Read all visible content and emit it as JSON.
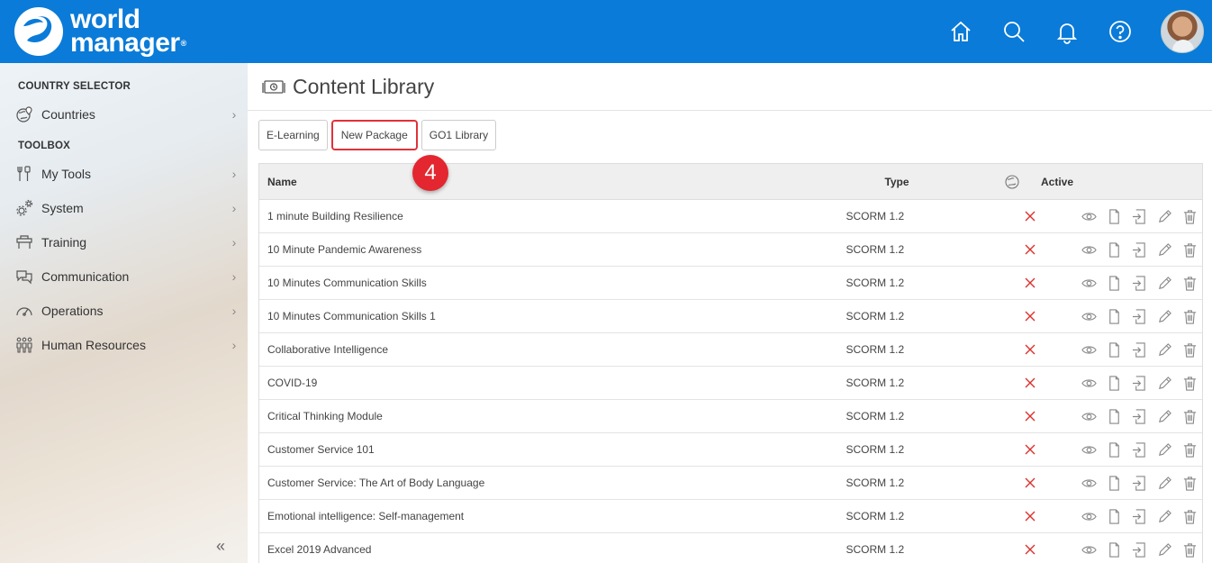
{
  "header": {
    "logo_line1": "world",
    "logo_line2": "manager",
    "logo_reg": "®"
  },
  "sidebar": {
    "sections": [
      {
        "title": "COUNTRY SELECTOR",
        "items": [
          {
            "label": "Countries",
            "icon": "globe-pin-icon"
          }
        ]
      },
      {
        "title": "TOOLBOX",
        "items": [
          {
            "label": "My Tools",
            "icon": "tools-icon"
          },
          {
            "label": "System",
            "icon": "gears-icon"
          },
          {
            "label": "Training",
            "icon": "training-icon"
          },
          {
            "label": "Communication",
            "icon": "chat-icon"
          },
          {
            "label": "Operations",
            "icon": "gauge-icon"
          },
          {
            "label": "Human Resources",
            "icon": "people-icon"
          }
        ]
      }
    ],
    "collapse_glyph": "«"
  },
  "main": {
    "title": "Content Library",
    "tabs": [
      {
        "label": "E-Learning",
        "highlight": false
      },
      {
        "label": "New Package",
        "highlight": true
      },
      {
        "label": "GO1 Library",
        "highlight": false
      }
    ],
    "step_badge": "4",
    "table": {
      "headers": {
        "name": "Name",
        "type": "Type",
        "active": "Active"
      },
      "rows": [
        {
          "name": "1 minute Building Resilience",
          "type": "SCORM 1.2"
        },
        {
          "name": "10 Minute Pandemic Awareness",
          "type": "SCORM 1.2"
        },
        {
          "name": "10 Minutes Communication Skills",
          "type": "SCORM 1.2"
        },
        {
          "name": "10 Minutes Communication Skills 1",
          "type": "SCORM 1.2"
        },
        {
          "name": "Collaborative Intelligence",
          "type": "SCORM 1.2"
        },
        {
          "name": "COVID-19",
          "type": "SCORM 1.2"
        },
        {
          "name": "Critical Thinking Module",
          "type": "SCORM 1.2"
        },
        {
          "name": "Customer Service 101",
          "type": "SCORM 1.2"
        },
        {
          "name": "Customer Service: The Art of Body Language",
          "type": "SCORM 1.2"
        },
        {
          "name": "Emotional intelligence: Self-management",
          "type": "SCORM 1.2"
        },
        {
          "name": "Excel 2019 Advanced",
          "type": "SCORM 1.2"
        }
      ]
    }
  },
  "colors": {
    "header_bg": "#0a7bd8",
    "highlight": "#e0323a",
    "inactive_x": "#d9322e"
  }
}
